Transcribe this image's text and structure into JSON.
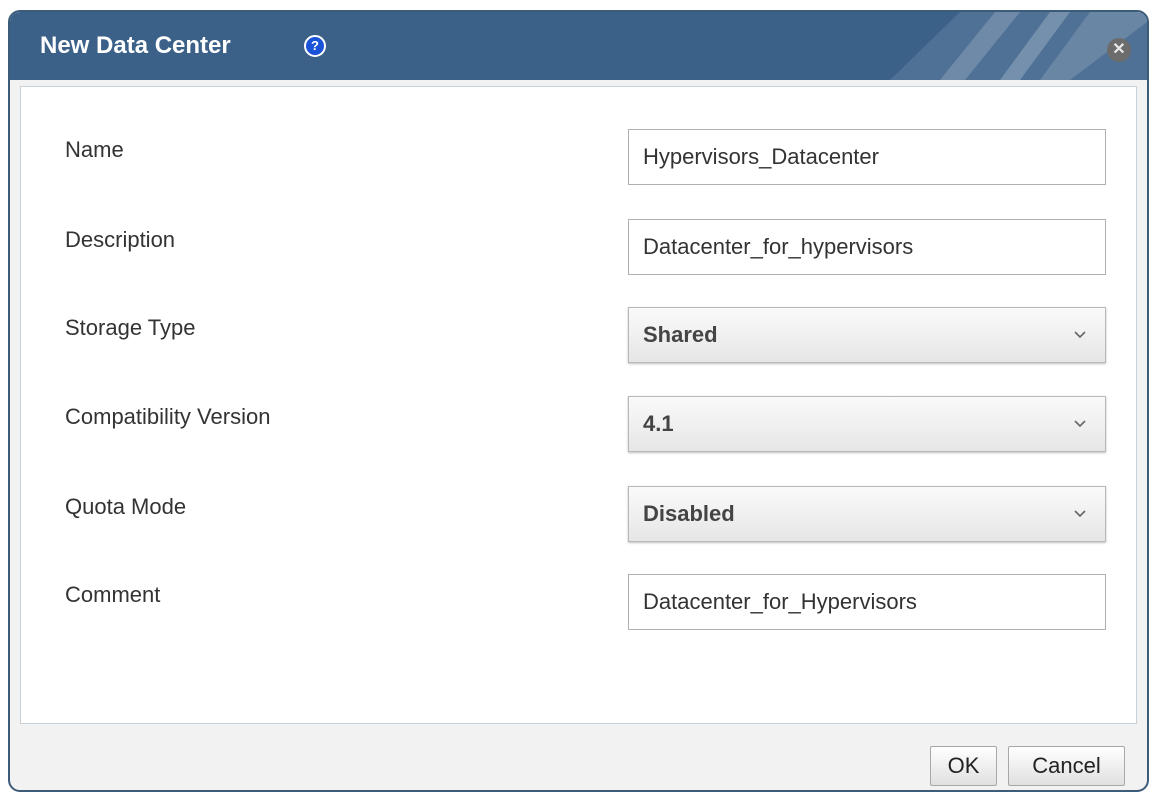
{
  "dialog": {
    "title": "New Data Center",
    "help_icon": "help-icon",
    "help_glyph": "?",
    "close_icon": "close-icon",
    "close_glyph": "✕"
  },
  "form": {
    "name": {
      "label": "Name",
      "value": "Hypervisors_Datacenter"
    },
    "description": {
      "label": "Description",
      "value": "Datacenter_for_hypervisors"
    },
    "storage_type": {
      "label": "Storage Type",
      "selected": "Shared"
    },
    "compatibility_version": {
      "label": "Compatibility Version",
      "selected": "4.1"
    },
    "quota_mode": {
      "label": "Quota Mode",
      "selected": "Disabled"
    },
    "comment": {
      "label": "Comment",
      "value": "Datacenter_for_Hypervisors"
    }
  },
  "footer": {
    "ok_label": "OK",
    "cancel_label": "Cancel"
  },
  "colors": {
    "titlebar": "#3b6189",
    "help_icon": "#1a52d8",
    "dialog_border": "#3d5c7a"
  }
}
